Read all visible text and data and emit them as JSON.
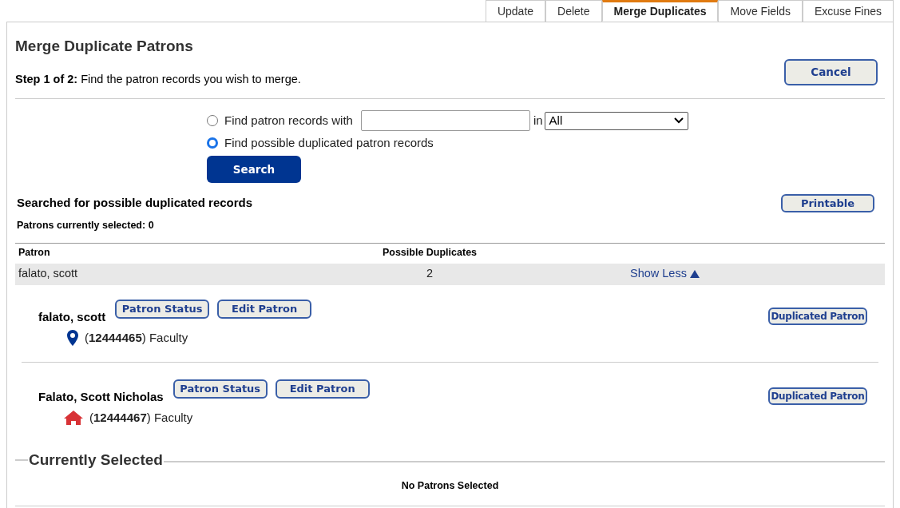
{
  "tabs": [
    {
      "label": "Update",
      "selected": false
    },
    {
      "label": "Delete",
      "selected": false
    },
    {
      "label": "Merge Duplicates",
      "selected": true
    },
    {
      "label": "Move Fields",
      "selected": false
    },
    {
      "label": "Excuse Fines",
      "selected": false
    }
  ],
  "title": "Merge Duplicate Patrons",
  "step": "**Step 1 of 2:** Find the patron records you wish to merge.",
  "cancel_button": "Cancel",
  "search_options": [
    {
      "label": "Find patron records with",
      "selected": false,
      "kind": "field"
    },
    {
      "label": "Find possible duplicated patron records",
      "selected": true,
      "kind": "plain"
    }
  ],
  "search_in_label": "in",
  "search_scope": "All",
  "search_button": "Search",
  "results_heading": "Searched for possible duplicated records",
  "selected_count": "Patrons currently selected: 0",
  "printable_button": "Printable",
  "table": {
    "columns": [
      "Patron",
      "Possible Duplicates"
    ],
    "rows": [
      {
        "patron": "falato, scott",
        "duplicates": "2",
        "toggle": "Show Less",
        "expanded": true
      }
    ]
  },
  "patrons": [
    {
      "name": "falato, scott",
      "buttons": [
        "Patron Status",
        "Edit Patron"
      ],
      "kind": "pin",
      "id_line": "(**12444465**) Faculty",
      "action": "Duplicated Patron"
    },
    {
      "name": "Falato, Scott Nicholas",
      "buttons": [
        "Patron Status",
        "Edit Patron"
      ],
      "kind": "home",
      "id_line": "(**12444467**) Faculty",
      "action": "Duplicated Patron"
    }
  ],
  "currently_selected": {
    "title": "Currently Selected",
    "empty_text": "No Patrons Selected"
  }
}
